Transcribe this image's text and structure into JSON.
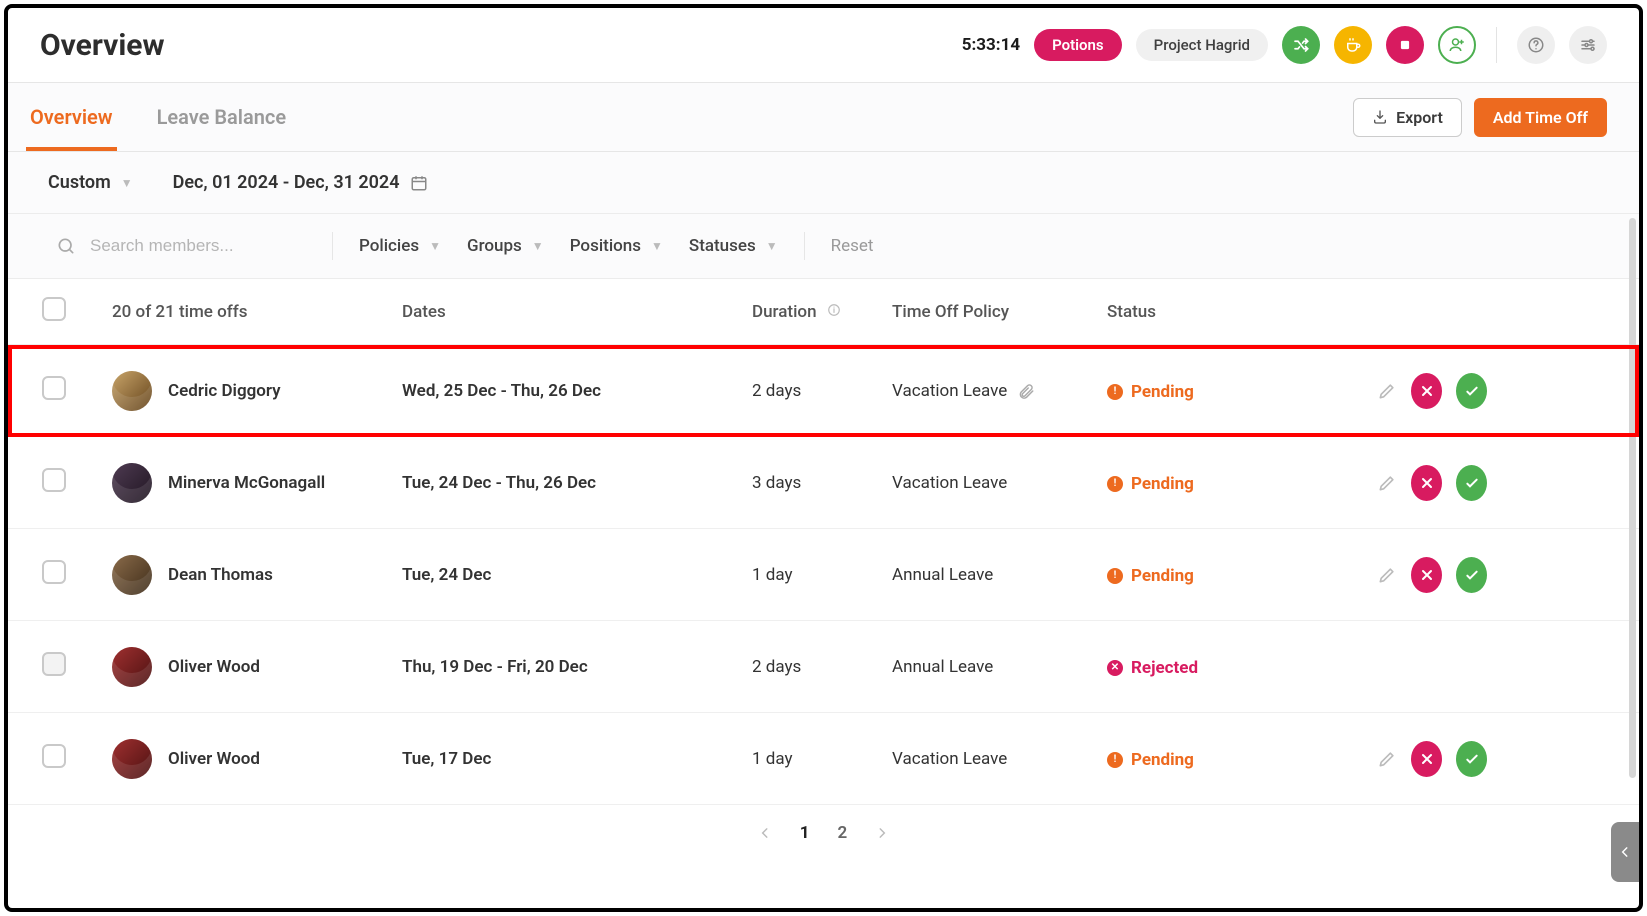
{
  "header": {
    "title": "Overview",
    "timer": "5:33:14",
    "pill_primary": "Potions",
    "pill_secondary": "Project Hagrid"
  },
  "tabs": {
    "items": [
      "Overview",
      "Leave Balance"
    ],
    "active_index": 0,
    "export_label": "Export",
    "add_label": "Add Time Off"
  },
  "date_filter": {
    "mode": "Custom",
    "range": "Dec, 01 2024 - Dec, 31 2024"
  },
  "filters": {
    "search_placeholder": "Search members...",
    "policies": "Policies",
    "groups": "Groups",
    "positions": "Positions",
    "statuses": "Statuses",
    "reset": "Reset"
  },
  "table": {
    "count_label": "20 of 21 time offs",
    "cols": {
      "dates": "Dates",
      "duration": "Duration",
      "policy": "Time Off Policy",
      "status": "Status"
    }
  },
  "rows": [
    {
      "name": "Cedric Diggory",
      "dates": "Wed, 25 Dec - Thu, 26 Dec",
      "duration": "2 days",
      "policy": "Vacation Leave",
      "attachment": true,
      "status": "Pending",
      "actions": true,
      "highlight": true,
      "disabled": false
    },
    {
      "name": "Minerva McGonagall",
      "dates": "Tue, 24 Dec - Thu, 26 Dec",
      "duration": "3 days",
      "policy": "Vacation Leave",
      "attachment": false,
      "status": "Pending",
      "actions": true,
      "highlight": false,
      "disabled": false
    },
    {
      "name": "Dean Thomas",
      "dates": "Tue, 24 Dec",
      "duration": "1 day",
      "policy": "Annual Leave",
      "attachment": false,
      "status": "Pending",
      "actions": true,
      "highlight": false,
      "disabled": false
    },
    {
      "name": "Oliver Wood",
      "dates": "Thu, 19 Dec - Fri, 20 Dec",
      "duration": "2 days",
      "policy": "Annual Leave",
      "attachment": false,
      "status": "Rejected",
      "actions": false,
      "highlight": false,
      "disabled": true
    },
    {
      "name": "Oliver Wood",
      "dates": "Tue, 17 Dec",
      "duration": "1 day",
      "policy": "Vacation Leave",
      "attachment": false,
      "status": "Pending",
      "actions": true,
      "highlight": false,
      "disabled": false
    }
  ],
  "pagination": {
    "pages": [
      "1",
      "2"
    ],
    "active": 0
  }
}
